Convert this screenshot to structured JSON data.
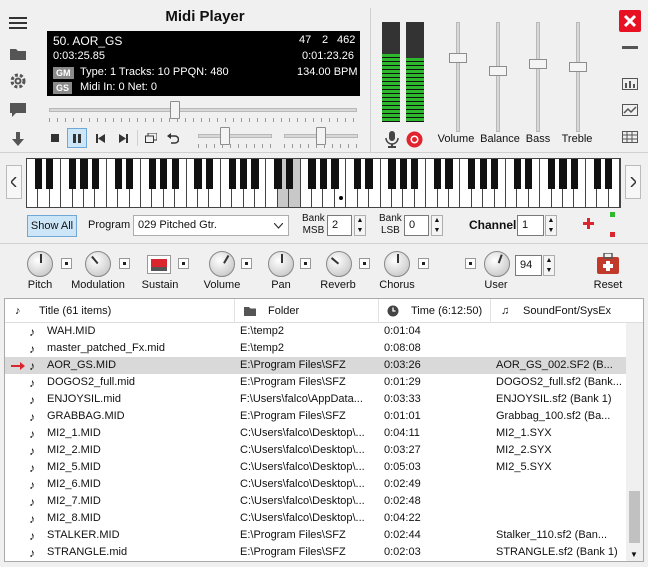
{
  "app": {
    "title": "Midi Player"
  },
  "display": {
    "track_name": "50. AOR_GS",
    "elapsed": "0:03:25.85",
    "counter_a": "47",
    "counter_b": "2",
    "counter_c": "462",
    "duration": "0:01:23.26",
    "badge_gm": "GM",
    "badge_gs": "GS",
    "type_info": "Type: 1  Tracks: 10  PPQN: 480",
    "bpm": "134.00 BPM",
    "midi_info": "Midi In: 0  Net: 0"
  },
  "mixer": {
    "labels": {
      "volume": "Volume",
      "balance": "Balance",
      "bass": "Bass",
      "treble": "Treble"
    }
  },
  "program_row": {
    "show_all": "Show All",
    "program_label": "Program",
    "program_value": "029 Pitched Gtr.",
    "bank_msb_label_1": "Bank",
    "bank_msb_label_2": "MSB",
    "bank_msb_value": "2",
    "bank_lsb_label_1": "Bank",
    "bank_lsb_label_2": "LSB",
    "bank_lsb_value": "0",
    "channel_label": "Channel",
    "channel_value": "1"
  },
  "controls": {
    "pitch": "Pitch",
    "modulation": "Modulation",
    "sustain": "Sustain",
    "volume": "Volume",
    "pan": "Pan",
    "reverb": "Reverb",
    "chorus": "Chorus",
    "user": "User",
    "user_value": "94",
    "reset": "Reset"
  },
  "list": {
    "columns": {
      "title": "Title (61 items)",
      "folder": "Folder",
      "time": "Time (6:12:50)",
      "soundfont": "SoundFont/SysEx"
    },
    "rows": [
      {
        "title": "WAH.MID",
        "folder": "E:\\temp2",
        "time": "0:01:04",
        "sf": ""
      },
      {
        "title": "master_patched_Fx.mid",
        "folder": "E:\\temp2",
        "time": "0:08:08",
        "sf": ""
      },
      {
        "title": "AOR_GS.MID",
        "folder": "E:\\Program Files\\SFZ",
        "time": "0:03:26",
        "sf": "AOR_GS_002.SF2 (B..."
      },
      {
        "title": "DOGOS2_full.mid",
        "folder": "E:\\Program Files\\SFZ",
        "time": "0:01:29",
        "sf": "DOGOS2_full.sf2 (Bank..."
      },
      {
        "title": "ENJOYSIL.mid",
        "folder": "F:\\Users\\falco\\AppData...",
        "time": "0:03:33",
        "sf": "ENJOYSIL.sf2 (Bank 1)"
      },
      {
        "title": "GRABBAG.MID",
        "folder": "E:\\Program Files\\SFZ",
        "time": "0:01:01",
        "sf": "Grabbag_100.sf2 (Ba..."
      },
      {
        "title": "MI2_1.MID",
        "folder": "C:\\Users\\falco\\Desktop\\...",
        "time": "0:04:11",
        "sf": "MI2_1.SYX"
      },
      {
        "title": "MI2_2.MID",
        "folder": "C:\\Users\\falco\\Desktop\\...",
        "time": "0:03:27",
        "sf": "MI2_2.SYX"
      },
      {
        "title": "MI2_5.MID",
        "folder": "C:\\Users\\falco\\Desktop\\...",
        "time": "0:05:03",
        "sf": "MI2_5.SYX"
      },
      {
        "title": "MI2_6.MID",
        "folder": "C:\\Users\\falco\\Desktop\\...",
        "time": "0:02:49",
        "sf": ""
      },
      {
        "title": "MI2_7.MID",
        "folder": "C:\\Users\\falco\\Desktop\\...",
        "time": "0:02:48",
        "sf": ""
      },
      {
        "title": "MI2_8.MID",
        "folder": "C:\\Users\\falco\\Desktop\\...",
        "time": "0:04:22",
        "sf": ""
      },
      {
        "title": "STALKER.MID",
        "folder": "E:\\Program Files\\SFZ",
        "time": "0:02:44",
        "sf": "Stalker_110.sf2 (Ban..."
      },
      {
        "title": "STRANGLE.mid",
        "folder": "E:\\Program Files\\SFZ",
        "time": "0:02:03",
        "sf": "STRANGLE.sf2 (Bank 1)"
      }
    ],
    "selected_index": 2
  },
  "colors": {
    "accent_blue": "#cde6f7",
    "close_red": "#e81123",
    "record_red": "#e0242e",
    "vu_green": "#2eb82e",
    "vu_red": "#e02020"
  }
}
